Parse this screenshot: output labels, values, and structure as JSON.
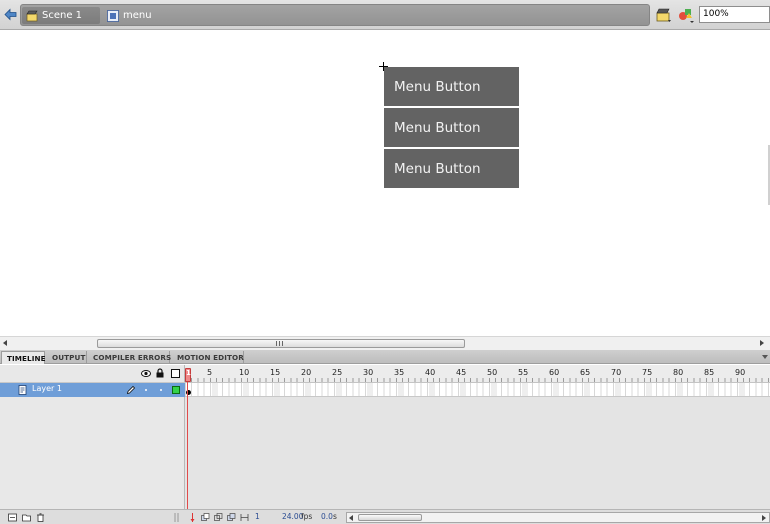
{
  "editbar": {
    "scene_label": "Scene 1",
    "symbol_label": "menu",
    "zoom_value": "100%",
    "icons": [
      "back-arrow-icon",
      "scene-icon",
      "movieclip-symbol-icon",
      "edit-scene-icon",
      "edit-symbols-icon"
    ]
  },
  "stage": {
    "menu_buttons": [
      "Menu Button",
      "Menu Button",
      "Menu Button"
    ],
    "button_color": "#636363",
    "button_text_color": "#f2f2f2"
  },
  "panel_tabs": [
    "TIMELINE",
    "OUTPUT",
    "COMPILER ERRORS",
    "MOTION EDITOR"
  ],
  "timeline": {
    "ruler_labels": [
      "5",
      "10",
      "15",
      "20",
      "25",
      "30",
      "35",
      "40",
      "45",
      "50",
      "55",
      "60",
      "65",
      "70",
      "75",
      "80",
      "85",
      "90"
    ],
    "current_frame_marker": "1",
    "layers": [
      {
        "name": "Layer 1",
        "selected": true,
        "outline_color": "#33d14a"
      }
    ],
    "header_icons": [
      "eye-icon",
      "lock-icon",
      "outline-icon"
    ],
    "footer": {
      "current_frame": "1",
      "fps_value": "24.00",
      "fps_unit": "fps",
      "time_value": "0.0",
      "time_unit": "s"
    }
  },
  "colors": {
    "layer_selected": "#6f9ed8",
    "playhead": "#e14a4a",
    "info_text": "#2b4c92"
  }
}
